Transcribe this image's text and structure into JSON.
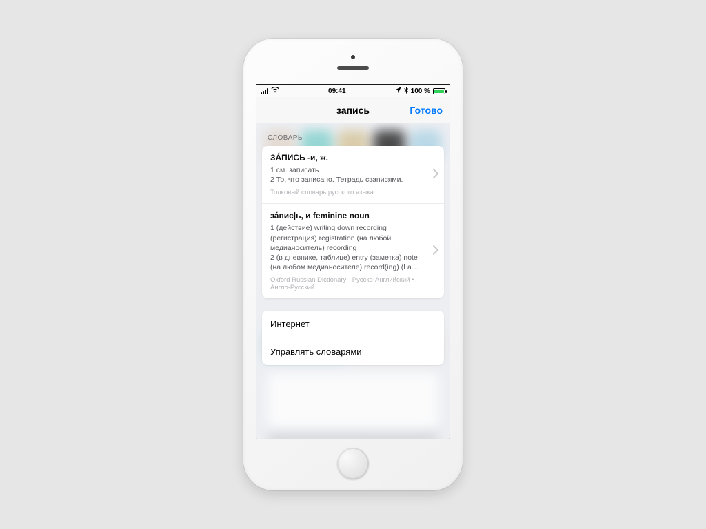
{
  "status": {
    "time": "09:41",
    "battery_text": "100 %",
    "wifi_glyph": "▶",
    "location_glyph": "➤",
    "bluetooth_glyph": "$"
  },
  "nav": {
    "title": "запись",
    "done": "Готово"
  },
  "section_header": "СЛОВАРЬ",
  "entries": [
    {
      "title": "ЗА́ПИСЬ -и, ж.",
      "body": "1 см. записать.\n2 То, что записано. Тетрадь сзаписями.",
      "source": "Толковый словарь русского языка"
    },
    {
      "title": "за́пис|ь, и feminine noun",
      "body": "1 (действие) writing down recording (регистрация) registration (на любой медианоситель) recording\n2 (в дневнике, таблице) entry (заметка) note (на любом медианосителе) record(ing) (Law) deed (Computing, массив информации, обрабатывае…",
      "source": "Oxford Russian Dictionary - Русско-Английский • Англо-Русский"
    }
  ],
  "actions": {
    "web": "Интернет",
    "manage": "Управлять словарями"
  }
}
